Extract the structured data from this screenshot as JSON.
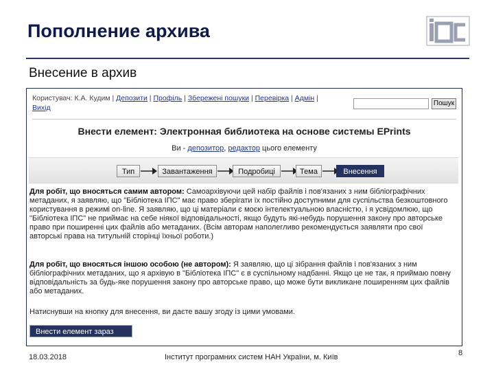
{
  "slide": {
    "title": "Пополнение архива",
    "subtitle": "Внесение в архив",
    "logo_text": "iПС",
    "footer": {
      "date": "18.03.2018",
      "institute": "Інститут програмних систем НАН України, м. Київ",
      "page": "8"
    }
  },
  "topbar": {
    "user_prefix": "Користувач:",
    "user_name": "К.А. Кудим",
    "sep": "|",
    "links": [
      "Депозити",
      "Профіль",
      "Збережені пошуки",
      "Перевірка",
      "Адмін"
    ],
    "exit": "Вихід",
    "search_value": "",
    "search_button": "Пошук"
  },
  "eprint": {
    "title": "Внести елемент: Электронная библиотека на основе системы EPrints",
    "depositor_pre": "Ви - ",
    "depositor_link": "депозитор",
    "depositor_mid": ", ",
    "editor_link": "редактор",
    "depositor_post": " цього елементу"
  },
  "stages": [
    {
      "label": "Тип",
      "active": false
    },
    {
      "label": "Завантаження",
      "active": false
    },
    {
      "label": "Подробиці",
      "active": false
    },
    {
      "label": "Тема",
      "active": false
    },
    {
      "label": "Внесення",
      "active": true
    }
  ],
  "paragraphs": {
    "p1_bold": "Для робіт, що вносяться самим автором:",
    "p1_text": " Самоархівуючи цей набір файлів і пов'язаних з ним бібліографічних метаданих, я заявляю, що \"Бібліотека ІПС\" має право зберігати їх постійно доступними для суспільства безкоштовного користування в режимі on-line. Я заявляю, що ці матеріали є моєю інтелектуальною власністю, і я усвідомлюю, що \"Бібліотека ІПС\" не приймає на себе ніякої відповідальності, якщо будуть які-небудь порушення закону про авторське право при поширенні цих файлів або метаданих. (Всім авторам наполегливо рекомендується заявляти про свої авторські права на титульній сторінці їхньої роботи.)",
    "p2_bold": "Для робіт, що вносяться іншою особою (не автором):",
    "p2_text": " Я заявляю, що ці зібрання файлів і пов'язаних з ним бібліографічних метаданих, що я архівую в \"Бібліотека ІПС\" є в суспільному надбанні. Якщо це не так, я приймаю повну відповідальність за будь-яке порушення закону про авторське право, що може бути викликане поширенням цих файлів або метаданих.",
    "p3_text": "Натиснувши на кнопку для внесення, ви даєте вашу згоду із цими умовами."
  },
  "deposit_button": "Внести елемент зараз",
  "colors": {
    "accent": "#23325e",
    "link": "#1a33b0",
    "title": "#0d1a4a"
  }
}
